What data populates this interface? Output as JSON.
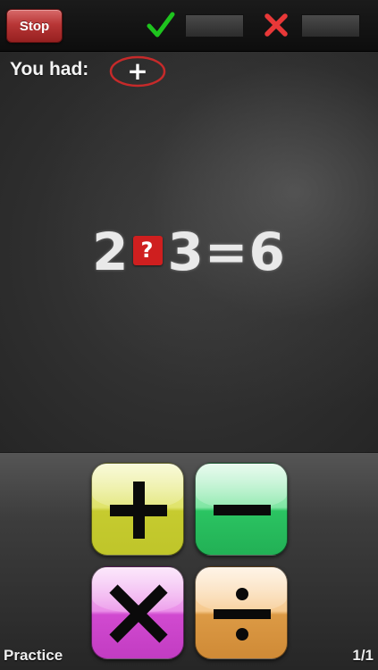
{
  "toolbar": {
    "stop_label": "Stop",
    "correct_icon": "checkmark-icon",
    "correct_count": "",
    "wrong_icon": "cross-icon",
    "wrong_count": ""
  },
  "board": {
    "you_had_label": "You had:",
    "previous_operator": "+",
    "equation": {
      "left": "2",
      "unknown": "?",
      "right": "3",
      "equals": "=",
      "result": "6"
    }
  },
  "operators": [
    {
      "name": "plus",
      "icon": "plus-icon",
      "color": "#d6da4a"
    },
    {
      "name": "minus",
      "icon": "minus-icon",
      "color": "#3ccc6e"
    },
    {
      "name": "times",
      "icon": "times-icon",
      "color": "#d65ad4"
    },
    {
      "name": "divide",
      "icon": "divide-icon",
      "color": "#e0a458"
    }
  ],
  "footer": {
    "mode": "Practice",
    "page": "1/1"
  },
  "colors": {
    "stop_button": "#b83636",
    "question_badge": "#cf1f1f",
    "correct": "#1ec41e",
    "wrong": "#e83838"
  }
}
